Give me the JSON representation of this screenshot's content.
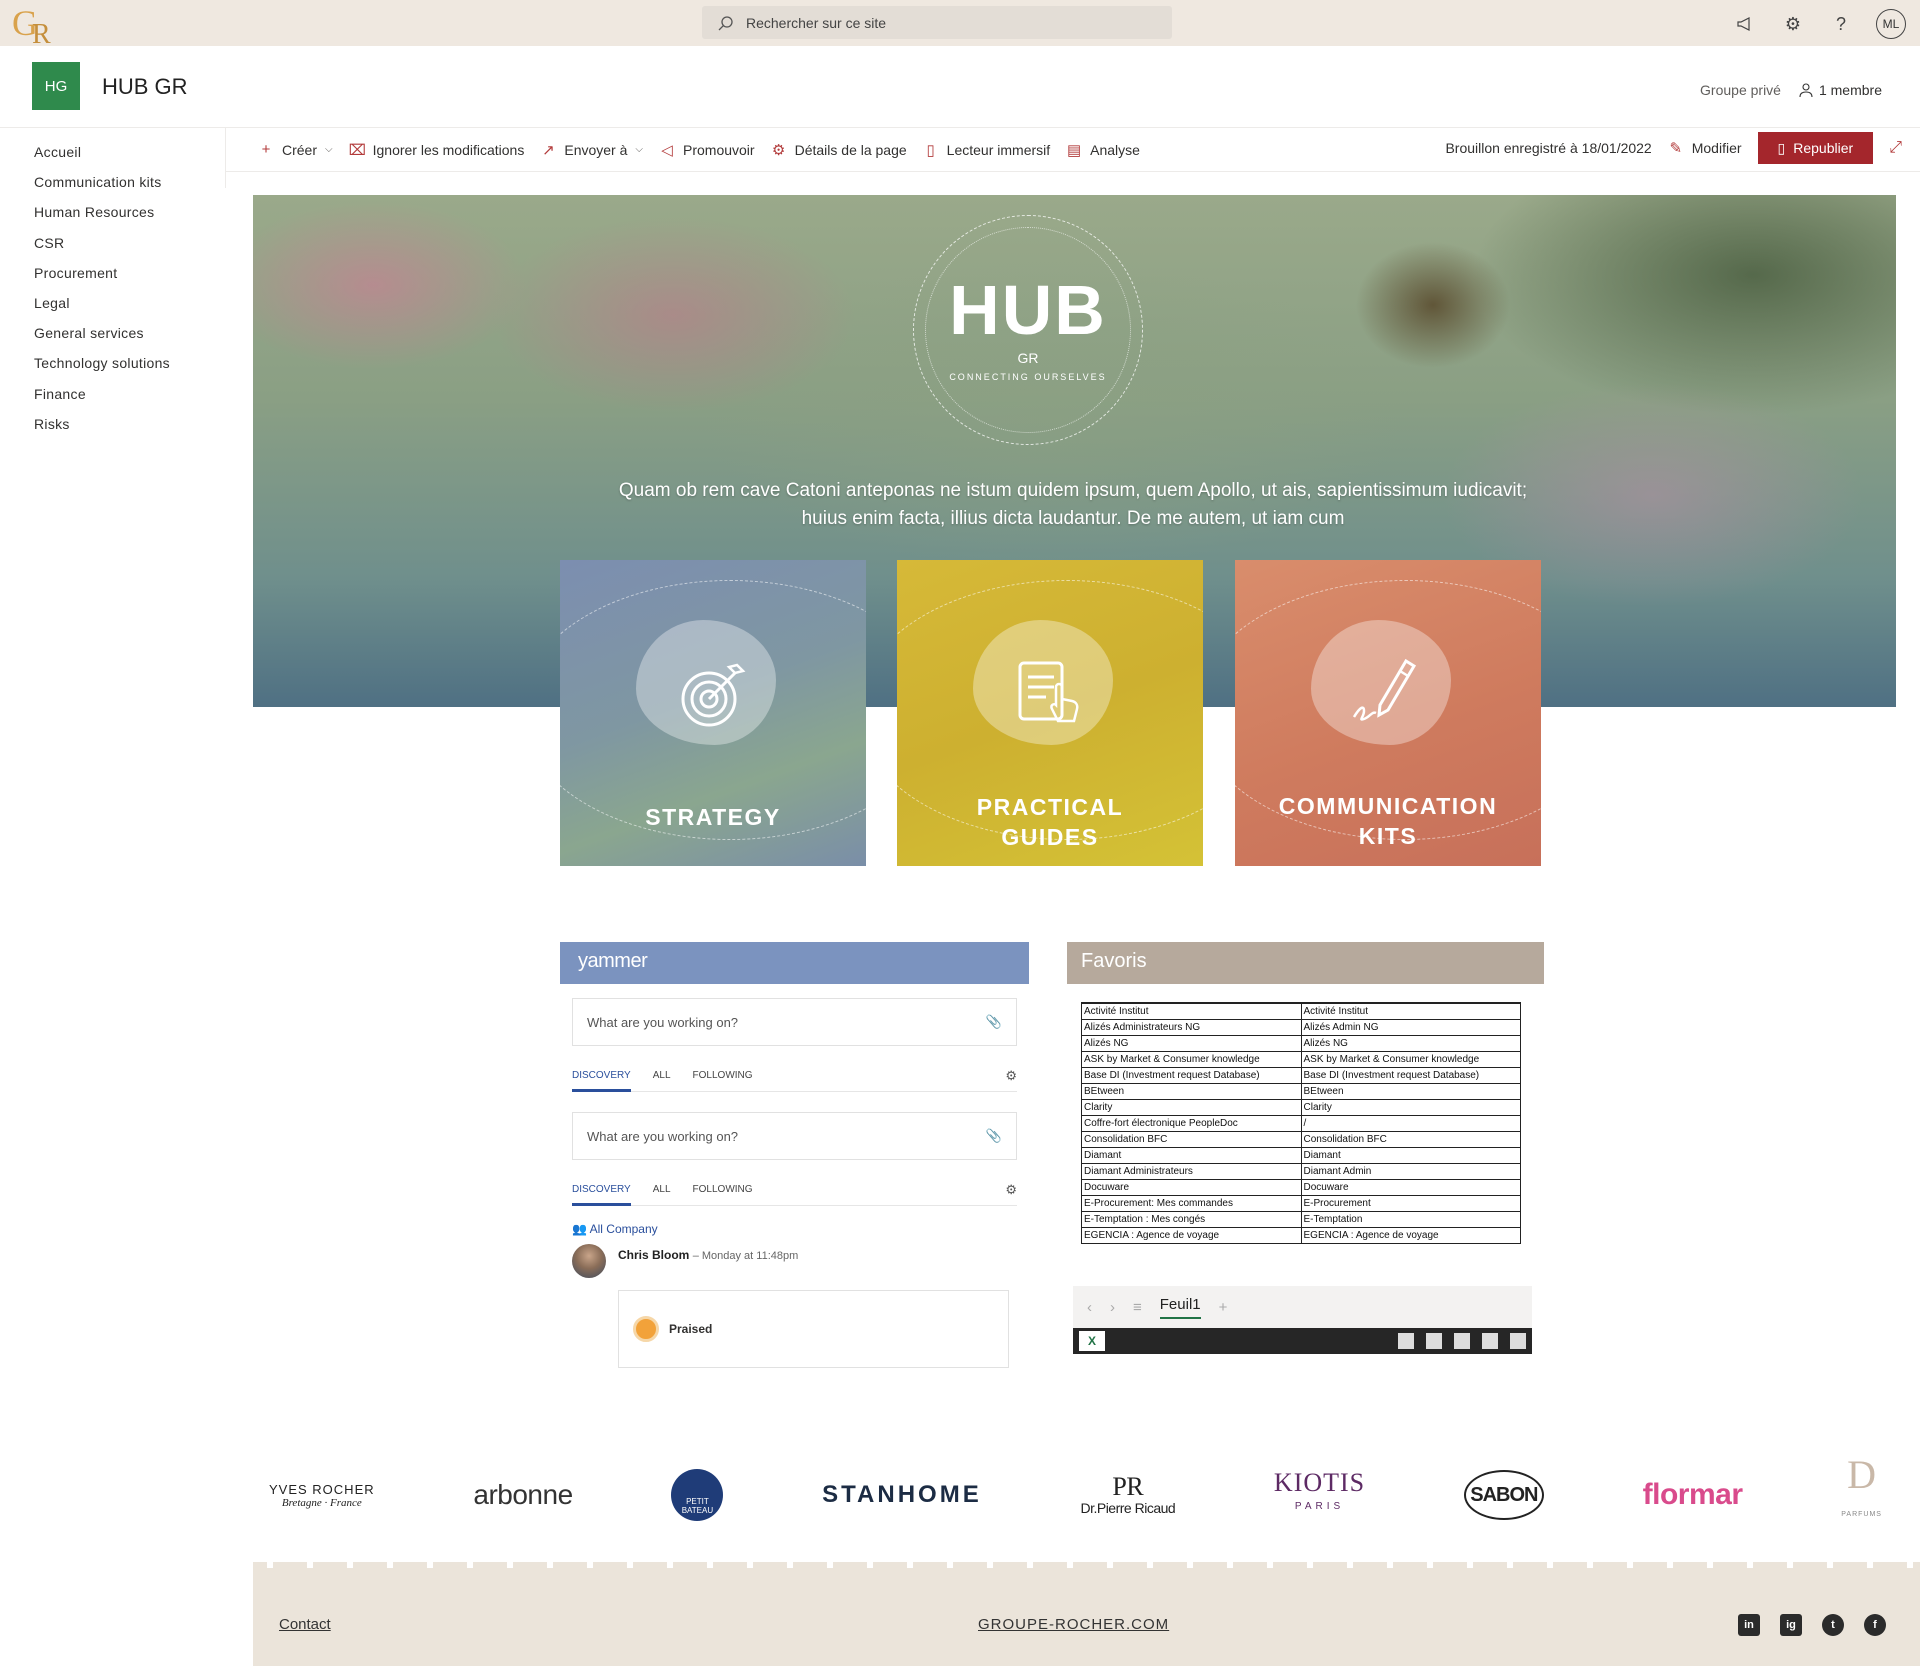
{
  "suite": {
    "logo": "GR",
    "search_placeholder": "Rechercher sur ce site",
    "avatar_initials": "ML",
    "icons": [
      "megaphone-icon",
      "gear-icon",
      "help-icon"
    ]
  },
  "site": {
    "logo_initials": "HG",
    "logo_color": "#2f8a4c",
    "title": "HUB GR",
    "privacy": "Groupe privé",
    "members": "1 membre"
  },
  "nav": {
    "items": [
      "Accueil",
      "Communication kits",
      "Human Resources",
      "CSR",
      "Procurement",
      "Legal",
      "General services",
      "Technology solutions",
      "Finance",
      "Risks"
    ]
  },
  "commands": {
    "create": "Créer",
    "discard": "Ignorer les modifications",
    "send": "Envoyer à",
    "promote": "Promouvoir",
    "page_details": "Détails de la page",
    "immersive": "Lecteur immersif",
    "analytics": "Analyse",
    "draft_status": "Brouillon enregistré à 18/01/2022",
    "edit": "Modifier",
    "republish": "Republier",
    "accent": "#a4262c"
  },
  "hero": {
    "logo_main": "HUB",
    "logo_sub": "GR",
    "logo_tagline": "CONNECTING OURSELVES",
    "description": "Quam ob rem cave Catoni anteponas ne istum quidem ipsum, quem Apollo, ut ais, sapientissimum iudicavit; huius enim facta, illius dicta laudantur. De me autem, ut iam cum"
  },
  "tiles": {
    "strategy": "STRATEGY",
    "guides_1": "PRACTICAL",
    "guides_2": "GUIDES",
    "kits_1": "COMMUNICATION",
    "kits_2": "KITS"
  },
  "yammer": {
    "header": "yammer",
    "composer_placeholder": "What are you working on?",
    "tabs": [
      "DISCOVERY",
      "ALL",
      "FOLLOWING"
    ],
    "group": "All Company",
    "post_author": "Chris Bloom",
    "post_time": "– Monday at 11:48pm",
    "praise": "Praised"
  },
  "favoris": {
    "header": "Favoris",
    "rows": [
      [
        "Activité Institut",
        "Activité Institut"
      ],
      [
        "Alizés Administrateurs NG",
        "Alizés Admin NG"
      ],
      [
        "Alizés NG",
        "Alizés NG"
      ],
      [
        "ASK by Market & Consumer knowledge",
        "ASK by Market & Consumer knowledge"
      ],
      [
        "Base DI (Investment request Database)",
        "Base DI (Investment request Database)"
      ],
      [
        "BEtween",
        "BEtween"
      ],
      [
        "Clarity",
        "Clarity"
      ],
      [
        "Coffre-fort électronique PeopleDoc",
        "/"
      ],
      [
        "Consolidation BFC",
        "Consolidation BFC"
      ],
      [
        "Diamant",
        "Diamant"
      ],
      [
        "Diamant Administrateurs",
        "Diamant Admin"
      ],
      [
        "Docuware",
        " Docuware"
      ],
      [
        "E-Procurement: Mes commandes",
        "E-Procurement"
      ],
      [
        "E-Temptation : Mes congés",
        "E-Temptation"
      ],
      [
        "EGENCIA : Agence de voyage",
        "EGENCIA : Agence de voyage"
      ]
    ],
    "sheet_name": "Feuil1",
    "excel_icon": "X"
  },
  "brands": {
    "yves": "YVES ROCHER",
    "yves_sub": "Bretagne · France",
    "arbonne": "arbonne",
    "petit": "PETIT BATEAU",
    "stanhome": "STANHOME",
    "pierre": "Dr.Pierre Ricaud",
    "pierre_mono": "PR",
    "kiotis": "KIOTIS",
    "kiotis_sub": "PARIS",
    "sabon": "SABON",
    "flormar": "flormar",
    "ptv": "D",
    "ptv_sub": "PARFUMS"
  },
  "footer": {
    "contact": "Contact",
    "site": "GROUPE-ROCHER.COM",
    "social": [
      "in",
      "ig",
      "t",
      "f"
    ]
  }
}
